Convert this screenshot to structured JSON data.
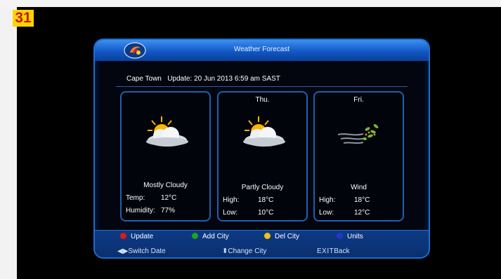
{
  "overlay_number": "31",
  "window": {
    "title": "Weather Forecast"
  },
  "header": {
    "city": "Cape Town",
    "update_text": "Update:  20 Jun 2013 6:59 am SAST"
  },
  "cards": [
    {
      "day": "",
      "condition": "Mostly Cloudy",
      "row1_label": "Temp:",
      "row1_value": "12°C",
      "row2_label": "Humidity:",
      "row2_value": "77%",
      "icon": "sun-cloud-icon"
    },
    {
      "day": "Thu.",
      "condition": "Partly Cloudy",
      "row1_label": "High:",
      "row1_value": "18°C",
      "row2_label": "Low:",
      "row2_value": "10°C",
      "icon": "sun-cloud-icon"
    },
    {
      "day": "Fri.",
      "condition": "Wind",
      "row1_label": "High:",
      "row1_value": "18°C",
      "row2_label": "Low:",
      "row2_value": "12°C",
      "icon": "wind-icon"
    }
  ],
  "color_keys": [
    {
      "label": "Update",
      "color": "#e01818"
    },
    {
      "label": "Add City",
      "color": "#1ea31e"
    },
    {
      "label": "Del City",
      "color": "#f2c20f"
    },
    {
      "label": "Units",
      "color": "#2535c8"
    }
  ],
  "nav": {
    "switch_date": "Switch Date",
    "change_city": "Change City",
    "exit_key": "EXIT",
    "exit_label": "Back"
  }
}
